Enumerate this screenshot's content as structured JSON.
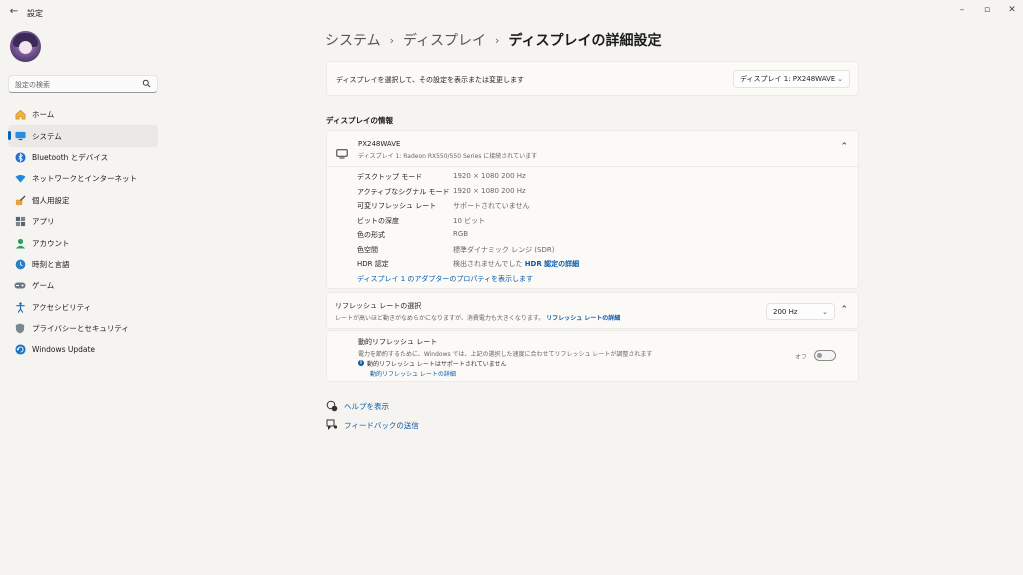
{
  "window": {
    "title": "設定",
    "back_icon": "back-arrow-icon",
    "minimize_icon": "minimize-icon",
    "maximize_icon": "maximize-icon",
    "close_icon": "close-icon"
  },
  "search": {
    "placeholder": "設定の検索",
    "icon": "search-icon"
  },
  "sidebar": {
    "items": [
      {
        "label": "ホーム",
        "icon": "home-icon",
        "active": false
      },
      {
        "label": "システム",
        "icon": "system-monitor-icon",
        "active": true
      },
      {
        "label": "Bluetooth とデバイス",
        "icon": "bluetooth-icon",
        "active": false
      },
      {
        "label": "ネットワークとインターネット",
        "icon": "network-icon",
        "active": false
      },
      {
        "label": "個人用設定",
        "icon": "personalization-brush-icon",
        "active": false
      },
      {
        "label": "アプリ",
        "icon": "apps-icon",
        "active": false
      },
      {
        "label": "アカウント",
        "icon": "account-icon",
        "active": false
      },
      {
        "label": "時刻と言語",
        "icon": "time-language-icon",
        "active": false
      },
      {
        "label": "ゲーム",
        "icon": "gaming-icon",
        "active": false
      },
      {
        "label": "アクセシビリティ",
        "icon": "accessibility-icon",
        "active": false
      },
      {
        "label": "プライバシーとセキュリティ",
        "icon": "shield-icon",
        "active": false
      },
      {
        "label": "Windows Update",
        "icon": "windows-update-icon",
        "active": false
      }
    ]
  },
  "breadcrumb": {
    "items": [
      "システム",
      "ディスプレイ",
      "ディスプレイの詳細設定"
    ]
  },
  "select_display": {
    "label": "ディスプレイを選択して、その設定を表示または変更します",
    "value": "ディスプレイ 1: PX248WAVE"
  },
  "display_info": {
    "section_title": "ディスプレイの情報",
    "monitor_name": "PX248WAVE",
    "monitor_sub": "ディスプレイ 1: Radeon RX550/550 Series に接続されています",
    "rows": [
      {
        "label": "デスクトップ モード",
        "value": "1920 × 1080 200 Hz"
      },
      {
        "label": "アクティブなシグナル モード",
        "value": "1920 × 1080 200 Hz"
      },
      {
        "label": "可変リフレッシュ レート",
        "value": "サポートされていません"
      },
      {
        "label": "ビットの深度",
        "value": "10 ビット"
      },
      {
        "label": "色の形式",
        "value": "RGB"
      },
      {
        "label": "色空間",
        "value": "標準ダイナミック レンジ (SDR)"
      }
    ],
    "hdr_label": "HDR 認定",
    "hdr_value": "検出されませんでした",
    "hdr_link": "HDR 認定の詳細",
    "adapter_link": "ディスプレイ 1 のアダプターのプロパティを表示します"
  },
  "refresh": {
    "title": "リフレッシュ レートの選択",
    "desc": "レートが高いほど動きがなめらかになりますが、消費電力も大きくなります。",
    "link": "リフレッシュ レートの詳細",
    "value": "200 Hz",
    "dynamic_title": "動的リフレッシュ レート",
    "dynamic_desc": "電力を節約するために、Windows では、上記の選択した速度に合わせてリフレッシュ レートが調整されます",
    "dynamic_note": "動的リフレッシュ レートはサポートされていません",
    "dynamic_link": "動的リフレッシュ レートの詳細",
    "toggle_label": "オフ",
    "toggle_on": false
  },
  "help": {
    "get_help": "ヘルプを表示",
    "feedback": "フィードバックの送信"
  }
}
